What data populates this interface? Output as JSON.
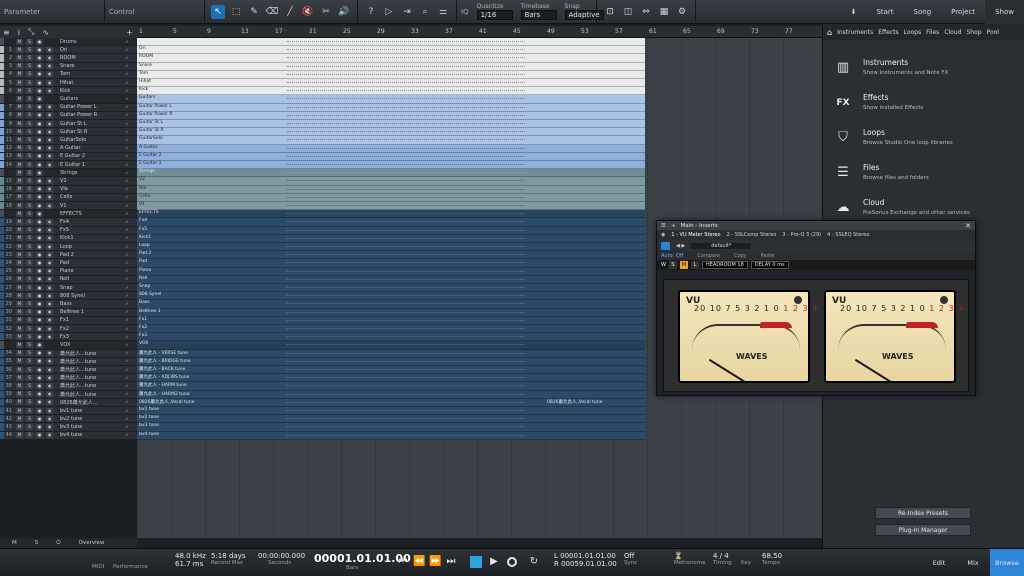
{
  "toolbar": {
    "parameter_label": "Parameter",
    "control_label": "Control",
    "quantize": {
      "caption": "Quantize",
      "value": "1/16"
    },
    "timebase": {
      "caption": "Timebase",
      "value": "Bars"
    },
    "snap": {
      "caption": "Snap",
      "value": "Adaptive"
    },
    "nav": [
      "Start",
      "Song",
      "Project",
      "Show"
    ]
  },
  "ruler": [
    "1",
    "5",
    "9",
    "13",
    "17",
    "21",
    "25",
    "29",
    "33",
    "37",
    "41",
    "45",
    "49",
    "53",
    "57",
    "61",
    "65",
    "69",
    "73",
    "77"
  ],
  "track_header_icons": [
    "≡",
    "i",
    "⤡",
    "∿",
    "+"
  ],
  "tracks": [
    {
      "type": "folder",
      "name": "Drums",
      "lane_color": "#e9eaea",
      "dark": false
    },
    {
      "num": "1",
      "name": "Ori",
      "lane_color": "#e9eaea",
      "color": "#bbbbbb",
      "dark": false,
      "lane_label": "Ori"
    },
    {
      "num": "2",
      "name": "ROOM",
      "lane_color": "#e9eaea",
      "color": "#bbbbbb",
      "dark": false,
      "lane_label": "ROOM"
    },
    {
      "num": "3",
      "name": "Snare",
      "lane_color": "#e9eaea",
      "color": "#bbbbbb",
      "dark": false,
      "lane_label": "Snare"
    },
    {
      "num": "4",
      "name": "Tom",
      "lane_color": "#e9eaea",
      "color": "#bbbbbb",
      "dark": false,
      "lane_label": "Tom"
    },
    {
      "num": "5",
      "name": "Hihat",
      "lane_color": "#e9eaea",
      "color": "#bbbbbb",
      "dark": false,
      "lane_label": "Hihat"
    },
    {
      "num": "6",
      "name": "Kick",
      "lane_color": "#e9eaea",
      "color": "#bbbbbb",
      "dark": false,
      "lane_label": "Kick"
    },
    {
      "type": "folder",
      "name": "Guitars",
      "lane_color": "#a9c3e6",
      "dark": false,
      "lane_label": "Guitars"
    },
    {
      "num": "7",
      "name": "Guitar Power L",
      "lane_color": "#a9c3e6",
      "color": "#7aa2d6",
      "dark": false,
      "lane_label": "Guitar Power L"
    },
    {
      "num": "8",
      "name": "Guitar Power R",
      "lane_color": "#a9c3e6",
      "color": "#7aa2d6",
      "dark": false,
      "lane_label": "Guitar Power R"
    },
    {
      "num": "9",
      "name": "Guitar St L",
      "lane_color": "#a9c3e6",
      "color": "#7aa2d6",
      "dark": false,
      "lane_label": "Guitar St L"
    },
    {
      "num": "10",
      "name": "Guitar St R",
      "lane_color": "#a9c3e6",
      "color": "#7aa2d6",
      "dark": false,
      "lane_label": "Guitar St R"
    },
    {
      "num": "11",
      "name": "GuitarSolo",
      "lane_color": "#a9c3e6",
      "color": "#7aa2d6",
      "dark": false,
      "lane_label": "GuitarSolo"
    },
    {
      "num": "12",
      "name": "A Guitar",
      "lane_color": "#8fb0dc",
      "color": "#7aa2d6",
      "dark": false,
      "lane_label": "A Guitar"
    },
    {
      "num": "13",
      "name": "E Guitar 2",
      "lane_color": "#8fb0dc",
      "color": "#7aa2d6",
      "dark": false,
      "lane_label": "E Guitar 2"
    },
    {
      "num": "14",
      "name": "E Guitar 1",
      "lane_color": "#8fb0dc",
      "color": "#7aa2d6",
      "dark": false,
      "lane_label": "E Guitar 1"
    },
    {
      "type": "folder",
      "name": "Strings",
      "lane_color": "#6f8f95",
      "dark": true,
      "lane_label": "Strings"
    },
    {
      "num": "15",
      "name": "V2",
      "lane_color": "#7c9aa0",
      "color": "#5f8d95",
      "dark": false,
      "lane_label": "V2"
    },
    {
      "num": "16",
      "name": "Vla",
      "lane_color": "#7c9aa0",
      "color": "#5f8d95",
      "dark": false,
      "lane_label": "Vla"
    },
    {
      "num": "17",
      "name": "Cello",
      "lane_color": "#7c9aa0",
      "color": "#5f8d95",
      "dark": false,
      "lane_label": "Cello"
    },
    {
      "num": "18",
      "name": "V1",
      "lane_color": "#7c9aa0",
      "color": "#5f8d95",
      "dark": false,
      "lane_label": "V1"
    },
    {
      "type": "folder",
      "name": "EFFECTS",
      "lane_color": "#27435f",
      "dark": true,
      "lane_label": "EFFECTS"
    },
    {
      "num": "19",
      "name": "Fx4",
      "lane_color": "#2b4a68",
      "color": "#2d5378",
      "dark": true,
      "lane_label": "Fx4"
    },
    {
      "num": "20",
      "name": "Fx5",
      "lane_color": "#2b4a68",
      "color": "#2d5378",
      "dark": true,
      "lane_label": "Fx5"
    },
    {
      "num": "21",
      "name": "Kick1",
      "lane_color": "#2b4a68",
      "color": "#2d5378",
      "dark": true,
      "lane_label": "Kick1"
    },
    {
      "num": "22",
      "name": "Loop",
      "lane_color": "#2b4a68",
      "color": "#2d5378",
      "dark": true,
      "lane_label": "Loop"
    },
    {
      "num": "23",
      "name": "Pad 2",
      "lane_color": "#2b4a68",
      "color": "#2d5378",
      "dark": true,
      "lane_label": "Pad 2"
    },
    {
      "num": "24",
      "name": "Pad",
      "lane_color": "#2b4a68",
      "color": "#2d5378",
      "dark": true,
      "lane_label": "Pad"
    },
    {
      "num": "25",
      "name": "Piano",
      "lane_color": "#2b4a68",
      "color": "#2d5378",
      "dark": true,
      "lane_label": "Piano"
    },
    {
      "num": "26",
      "name": "Roll",
      "lane_color": "#2b4a68",
      "color": "#2d5378",
      "dark": true,
      "lane_label": "Roll"
    },
    {
      "num": "27",
      "name": "Snap",
      "lane_color": "#2b4a68",
      "color": "#2d5378",
      "dark": true,
      "lane_label": "Snap"
    },
    {
      "num": "28",
      "name": "808 Synel",
      "lane_color": "#2b4a68",
      "color": "#2d5378",
      "dark": true,
      "lane_label": "808 Synel"
    },
    {
      "num": "29",
      "name": "Bass",
      "lane_color": "#2b4a68",
      "color": "#2d5378",
      "dark": true,
      "lane_label": "Bass"
    },
    {
      "num": "30",
      "name": "Belltree 1",
      "lane_color": "#2b4a68",
      "color": "#2d5378",
      "dark": true,
      "lane_label": "Belltree 1"
    },
    {
      "num": "31",
      "name": "Fx1",
      "lane_color": "#2b4a68",
      "color": "#2d5378",
      "dark": true,
      "lane_label": "Fx1"
    },
    {
      "num": "32",
      "name": "Fx2",
      "lane_color": "#2b4a68",
      "color": "#2d5378",
      "dark": true,
      "lane_label": "Fx2"
    },
    {
      "num": "33",
      "name": "Fx3",
      "lane_color": "#2b4a68",
      "color": "#2d5378",
      "dark": true,
      "lane_label": "Fx3"
    },
    {
      "type": "folder",
      "name": "VOX",
      "lane_color": "#264058",
      "dark": true,
      "lane_label": "VOX"
    },
    {
      "num": "34",
      "name": "蕭允此人...tune",
      "lane_color": "#2a4a66",
      "color": "#2d5378",
      "dark": true,
      "lane_label": "蕭允此人 - VERSE tune"
    },
    {
      "num": "35",
      "name": "蕭允此人...tune",
      "lane_color": "#2a4a66",
      "color": "#2d5378",
      "dark": true,
      "lane_label": "蕭允此人 - BRIDGE tune"
    },
    {
      "num": "36",
      "name": "蕭允此人...tune",
      "lane_color": "#2a4a66",
      "color": "#2d5378",
      "dark": true,
      "lane_label": "蕭允此人 - BACK tune"
    },
    {
      "num": "37",
      "name": "蕭允此人...tune",
      "lane_color": "#2a4a66",
      "color": "#2d5378",
      "dark": true,
      "lane_label": "蕭允此人 - ADLIBS tune"
    },
    {
      "num": "38",
      "name": "蕭允此人...tune",
      "lane_color": "#2a4a66",
      "color": "#2d5378",
      "dark": true,
      "lane_label": "蕭允此人 - HARM tune"
    },
    {
      "num": "39",
      "name": "蕭允此人...tune",
      "lane_color": "#2a4a66",
      "color": "#2d5378",
      "dark": true,
      "lane_label": "蕭允此人 - HARM2 tune"
    },
    {
      "num": "40",
      "name": "0826蕭允此人...",
      "lane_color": "#2a4a66",
      "color": "#2d5378",
      "dark": true,
      "lane_label": "0826蕭允此人_Vocal tune"
    },
    {
      "num": "41",
      "name": "bv1 tune",
      "lane_color": "#2a4a66",
      "color": "#2d5378",
      "dark": true,
      "lane_label": "bv1 tune"
    },
    {
      "num": "42",
      "name": "bv2 tune",
      "lane_color": "#2a4a66",
      "color": "#2d5378",
      "dark": true,
      "lane_label": "bv2 tune"
    },
    {
      "num": "43",
      "name": "bv3 tune",
      "lane_color": "#2a4a66",
      "color": "#2d5378",
      "dark": true,
      "lane_label": "bv3 tune"
    },
    {
      "num": "44",
      "name": "bv4 tune",
      "lane_color": "#2a4a66",
      "color": "#2d5378",
      "dark": true,
      "lane_label": "bv4 tune"
    }
  ],
  "track_buttons": [
    "M",
    "S",
    "●",
    "◉"
  ],
  "browser": {
    "tabs": [
      "Instruments",
      "Effects",
      "Loops",
      "Files",
      "Cloud",
      "Shop",
      "Pool"
    ],
    "items": [
      {
        "title": "Instruments",
        "desc": "Show Instruments and Note FX",
        "icon": "piano-icon"
      },
      {
        "title": "Effects",
        "desc": "Show installed Effects",
        "icon": "fx-icon"
      },
      {
        "title": "Loops",
        "desc": "Browse Studio One loop libraries",
        "icon": "loop-icon"
      },
      {
        "title": "Files",
        "desc": "Browse files and folders",
        "icon": "files-icon"
      },
      {
        "title": "Cloud",
        "desc": "PreSonus Exchange and other services",
        "icon": "cloud-icon"
      }
    ],
    "reindex_label": "Re-Index Presets",
    "plugin_manager_label": "Plug-In Manager"
  },
  "inserts": {
    "title": "Main - Inserts",
    "slots": [
      "1 - VU Meter Stereo",
      "2 - SSLComp Stereo",
      "3 - Pro-Q 3 (29)",
      "4 - SSLEQ Stereo"
    ],
    "preset": "default*",
    "auto": "Auto: Off",
    "compare": "Compare",
    "copy": "Copy",
    "paste": "Paste",
    "waves_s": "S",
    "waves_m": "M",
    "waves_l": "L",
    "headroom_label": "HEADROOM",
    "headroom_value": "18",
    "delay_label": "DELAY",
    "delay_value": "0 ms",
    "vu_label": "VU",
    "vu_scale_black": "20 10 7 5 3 2 1 0",
    "vu_scale_red": "1 2 3 +",
    "vu_logo": "WAVES"
  },
  "transport": {
    "midi_label": "MIDI",
    "performance_label": "Performance",
    "sample_rate": "48.0 kHz",
    "latency": "61.7 ms",
    "record_max_value": "5:18 days",
    "record_max_label": "Record Max",
    "seconds_value": "00:00:00.000",
    "seconds_label": "Seconds",
    "bars_value": "00001.01.01.00",
    "bars_label": "Bars",
    "loop_left": "00001.01.01.00",
    "loop_right": "00059.01.01.00",
    "sync_value": "Off",
    "sync_label": "Sync",
    "metronome_label": "Metronome",
    "timing_value": "4 / 4",
    "timing_label": "Timing",
    "key_label": "Key",
    "tempo_value": "68.50",
    "tempo_label": "Tempo",
    "tabs": [
      "Edit",
      "Mix",
      "Browse"
    ]
  },
  "status": {
    "m": "M",
    "s": "S",
    "overview": "Overview"
  }
}
